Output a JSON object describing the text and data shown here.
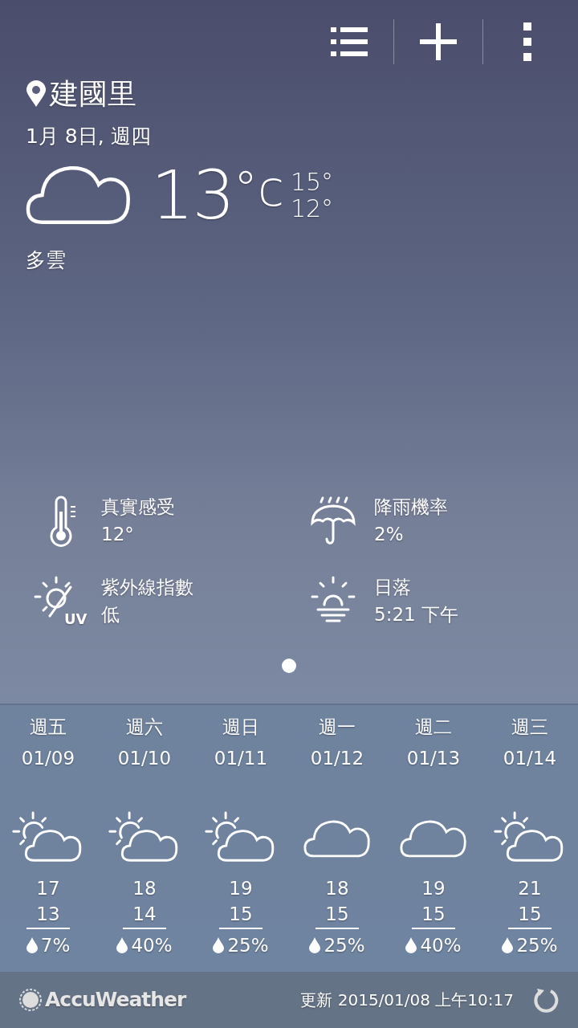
{
  "location": "建國里",
  "date": "1月 8日, 週四",
  "current": {
    "kind": "cloudy",
    "temp": "13",
    "unit": "°c",
    "high": "15°",
    "low": "12°",
    "condition": "多雲"
  },
  "details": [
    {
      "kind": "thermometer",
      "label": "真實感受",
      "value": "12°"
    },
    {
      "kind": "umbrella",
      "label": "降雨機率",
      "value": "2%"
    },
    {
      "kind": "uv",
      "badge": "UV",
      "label": "紫外線指數",
      "value": "低"
    },
    {
      "kind": "sunset",
      "label": "日落",
      "value": "5:21 下午"
    }
  ],
  "pages": [
    {
      "selected": true
    }
  ],
  "forecast": [
    {
      "day": "週五",
      "date": "01/09",
      "kind": "partly_cloudy",
      "high": "17",
      "low": "13",
      "rain": "7%"
    },
    {
      "day": "週六",
      "date": "01/10",
      "kind": "partly_cloudy",
      "high": "18",
      "low": "14",
      "rain": "40%"
    },
    {
      "day": "週日",
      "date": "01/11",
      "kind": "partly_cloudy",
      "high": "19",
      "low": "15",
      "rain": "25%"
    },
    {
      "day": "週一",
      "date": "01/12",
      "kind": "cloudy",
      "high": "18",
      "low": "15",
      "rain": "25%"
    },
    {
      "day": "週二",
      "date": "01/13",
      "kind": "cloudy",
      "high": "19",
      "low": "15",
      "rain": "40%"
    },
    {
      "day": "週三",
      "date": "01/14",
      "kind": "partly_cloudy",
      "high": "21",
      "low": "15",
      "rain": "25%"
    }
  ],
  "footer": {
    "brand": "AccuWeather",
    "updated": "更新 2015/01/08 上午10:17"
  }
}
